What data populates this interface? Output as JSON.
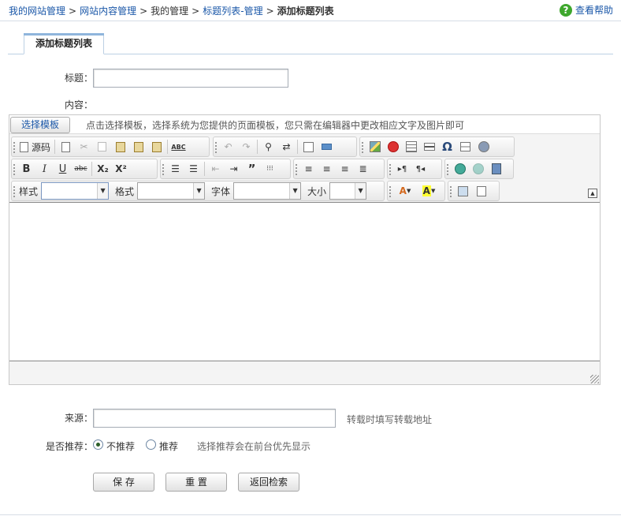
{
  "breadcrumb": {
    "items": [
      "我的网站管理",
      "网站内容管理",
      "我的管理",
      "标题列表-管理",
      "添加标题列表"
    ],
    "separator": ">"
  },
  "help": {
    "label": "查看帮助"
  },
  "tab": {
    "label": "添加标题列表"
  },
  "form": {
    "title_label": "标题：",
    "title_value": "",
    "content_label": "内容：",
    "source_label": "来源：",
    "source_value": "",
    "source_hint": "转载时填写转载地址",
    "recommend_label": "是否推荐：",
    "recommend_options": [
      {
        "label": "不推荐",
        "selected": true
      },
      {
        "label": "推荐",
        "selected": false
      }
    ],
    "recommend_hint": "选择推荐会在前台优先显示"
  },
  "editor": {
    "template_button": "选择模板",
    "template_hint": "点击选择模板，选择系统为您提供的页面模板，您只需在编辑器中更改相应文字及图片即可",
    "source_label": "源码",
    "style_label": "样式",
    "format_label": "格式",
    "font_label": "字体",
    "size_label": "大小",
    "bold": "B",
    "italic": "I",
    "underline": "U",
    "strike": "abc",
    "subscript": "X₂",
    "superscript": "X²",
    "special_char": "Ω",
    "spellcheck": "ABC"
  },
  "buttons": {
    "save": "保 存",
    "reset": "重 置",
    "back": "返回检索"
  },
  "colors": {
    "link": "#1a57a8",
    "help_icon": "#3ea72d"
  }
}
